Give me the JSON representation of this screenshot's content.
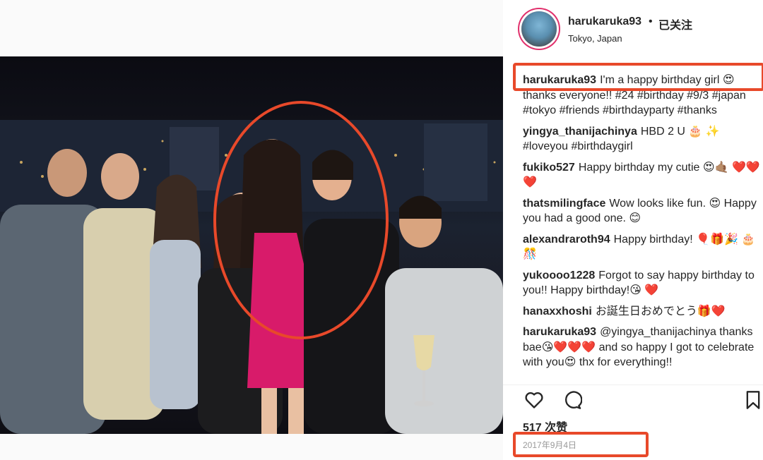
{
  "post": {
    "username": "harukaruka93",
    "separator": "•",
    "follow_label": "已关注",
    "location": "Tokyo, Japan",
    "likes": "517 次赞",
    "date": "2017年9月4日"
  },
  "comments": [
    {
      "user": "harukaruka93",
      "text": "I'm a happy birthday girl 😍 thanks everyone!! #24 #birthday #9/3 #japan #tokyo #friends #birthdayparty #thanks"
    },
    {
      "user": "yingya_thanijachinya",
      "text": "HBD 2 U 🎂 ✨ #loveyou #birthdaygirl"
    },
    {
      "user": "fukiko527",
      "text": "Happy birthday my cutie 😍🤙🏽 ❤️❤️❤️"
    },
    {
      "user": "thatsmilingface",
      "text": "Wow looks like fun. 😍 Happy you had a good one. 😊"
    },
    {
      "user": "alexandraroth94",
      "text": "Happy birthday! 🎈🎁🎉 🎂🎊"
    },
    {
      "user": "yukoooo1228",
      "text": "Forgot to say happy birthday to you!! Happy birthday!😘 ❤️"
    },
    {
      "user": "hanaxxhoshi",
      "text": "お誕生日おめでとう🎁❤️"
    },
    {
      "user": "harukaruka93",
      "text": "@yingya_thanijachinya thanks bae😘❤️❤️❤️ and so happy I got to celebrate with you😍 thx for everything!!"
    }
  ],
  "icons": {
    "like": "heart-icon",
    "comment": "comment-bubble-icon",
    "save": "bookmark-icon"
  },
  "colors": {
    "highlight": "#e8492a",
    "story_ring": "#e1306c",
    "hashtag": "#003569",
    "dress": "#d81b6a"
  }
}
